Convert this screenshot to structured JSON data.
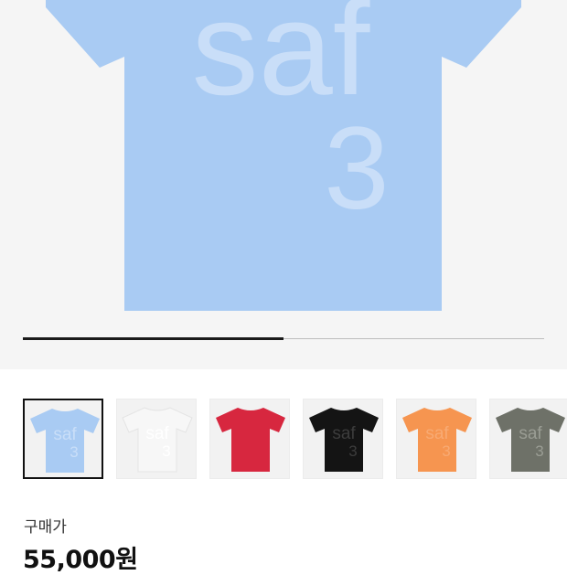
{
  "hero": {
    "graphic_lines": [
      "saf",
      "3"
    ],
    "color": "#a9cbf3",
    "text_color": "#c9def8",
    "image_position": 1,
    "image_count": 2
  },
  "thumbnails": [
    {
      "name": "sky-blue",
      "color": "#a9cbf3",
      "text_color": "#c9def8",
      "selected": true
    },
    {
      "name": "white",
      "color": "#f7f7f7",
      "text_color": "#ffffff",
      "selected": false
    },
    {
      "name": "red",
      "color": "#d7273f",
      "text_color": "#e04a5f",
      "selected": false
    },
    {
      "name": "black",
      "color": "#141414",
      "text_color": "#3c3c3c",
      "selected": false
    },
    {
      "name": "orange",
      "color": "#f69550",
      "text_color": "#f8aa73",
      "selected": false
    },
    {
      "name": "olive-gray",
      "color": "#6e7168",
      "text_color": "#9a9d94",
      "selected": false
    }
  ],
  "price": {
    "label": "구매가",
    "value": "55,000원"
  }
}
